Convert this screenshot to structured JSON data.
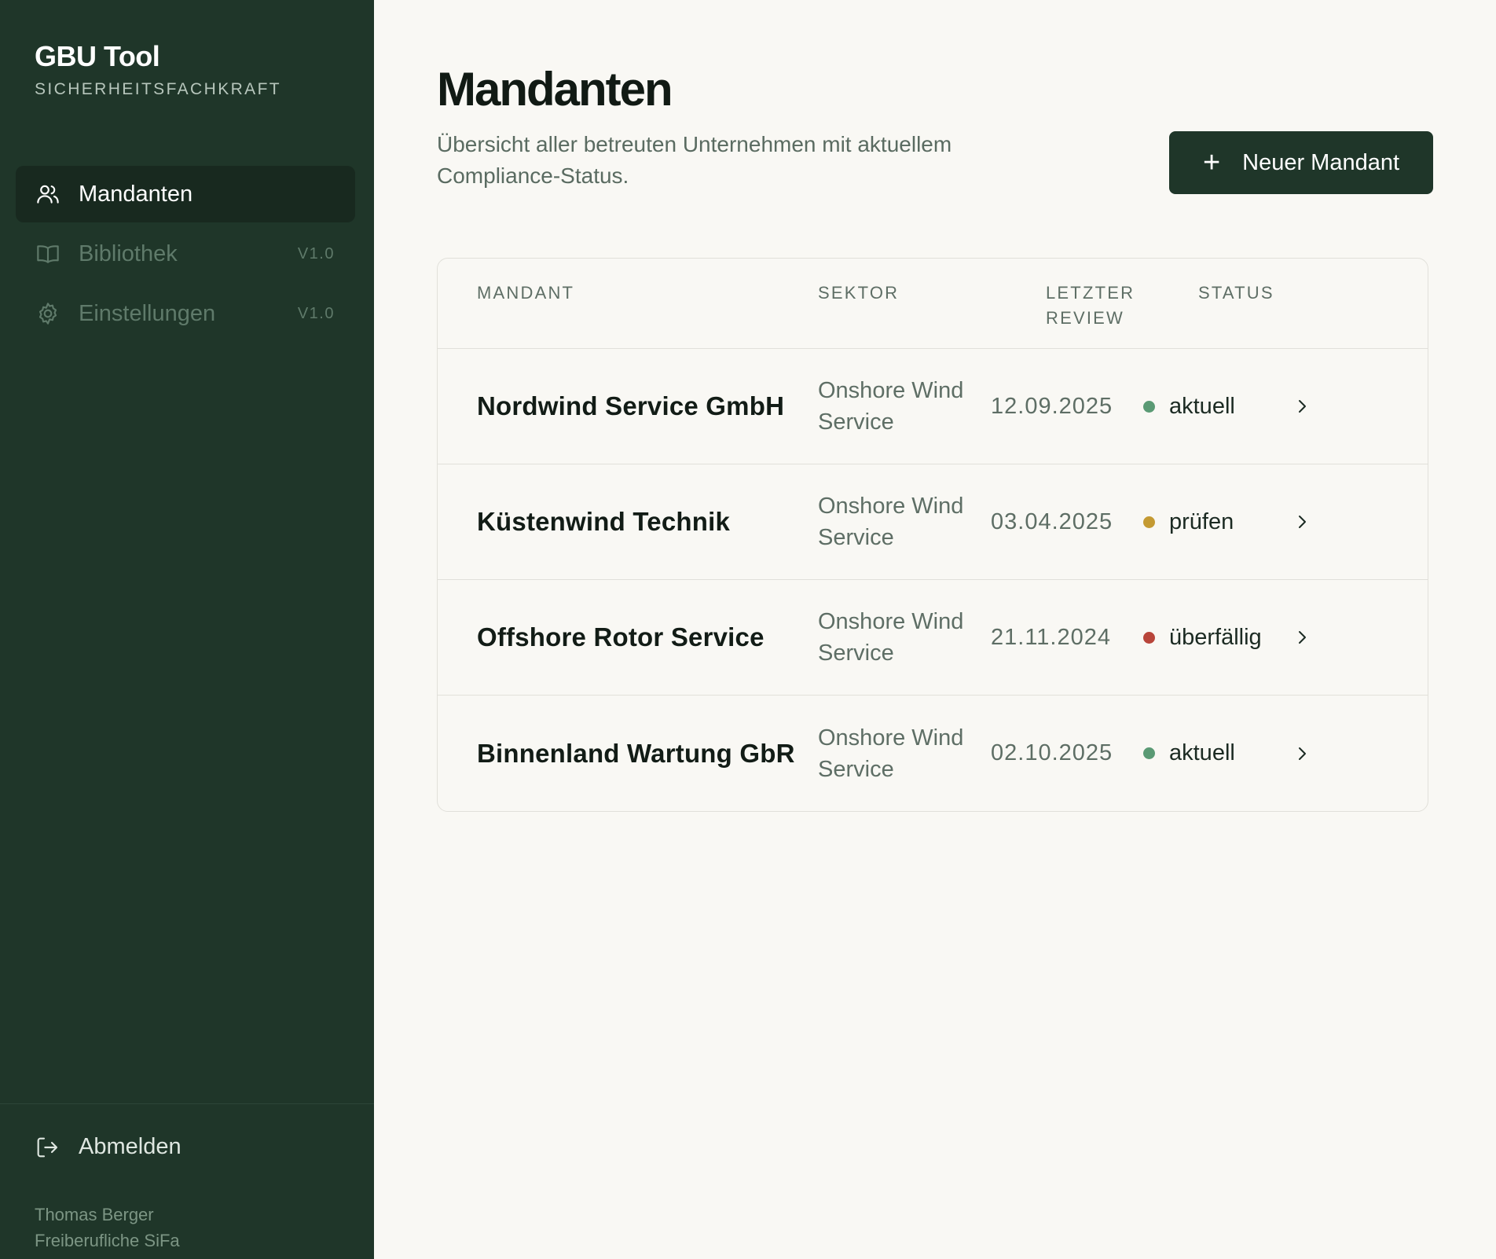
{
  "sidebar": {
    "brand_title": "GBU Tool",
    "brand_subtitle": "SICHERHEITSFACHKRAFT",
    "items": [
      {
        "label": "Mandanten",
        "icon": "users-icon",
        "version": "",
        "active": true
      },
      {
        "label": "Bibliothek",
        "icon": "book-icon",
        "version": "V1.0",
        "active": false
      },
      {
        "label": "Einstellungen",
        "icon": "gear-icon",
        "version": "V1.0",
        "active": false
      }
    ],
    "logout_label": "Abmelden",
    "logout_icon": "logout-icon",
    "user_name": "Thomas Berger",
    "user_role": "Freiberufliche SiFa"
  },
  "main": {
    "title": "Mandanten",
    "description": "Übersicht aller betreuten Unternehmen mit aktuellem Compliance-Status.",
    "new_button_label": "Neuer Mandant",
    "new_button_icon": "plus-icon",
    "table": {
      "headers": {
        "client": "MANDANT",
        "sector": "SEKTOR",
        "review_line1": "LETZTER",
        "review_line2": "REVIEW",
        "status": "STATUS"
      },
      "rows": [
        {
          "name": "Nordwind Service GmbH",
          "sector_line1": "Onshore Wind",
          "sector_line2": "Service",
          "last_review": "12.09.2025",
          "status": "aktuell",
          "status_color": "#5a9a74"
        },
        {
          "name": "Küstenwind Technik",
          "sector_line1": "Onshore Wind",
          "sector_line2": "Service",
          "last_review": "03.04.2025",
          "status": "prüfen",
          "status_color": "#c49a32"
        },
        {
          "name": "Offshore Rotor Service",
          "sector_line1": "Onshore Wind",
          "sector_line2": "Service",
          "last_review": "21.11.2024",
          "status": "überfällig",
          "status_color": "#b8453a"
        },
        {
          "name": "Binnenland Wartung GbR",
          "sector_line1": "Onshore Wind",
          "sector_line2": "Service",
          "last_review": "02.10.2025",
          "status": "aktuell",
          "status_color": "#5a9a74"
        }
      ]
    }
  },
  "colors": {
    "sidebar_bg": "#1f3629",
    "page_bg": "#f9f8f4",
    "accent": "#1f3629",
    "status_current": "#5a9a74",
    "status_check": "#c49a32",
    "status_overdue": "#b8453a"
  }
}
